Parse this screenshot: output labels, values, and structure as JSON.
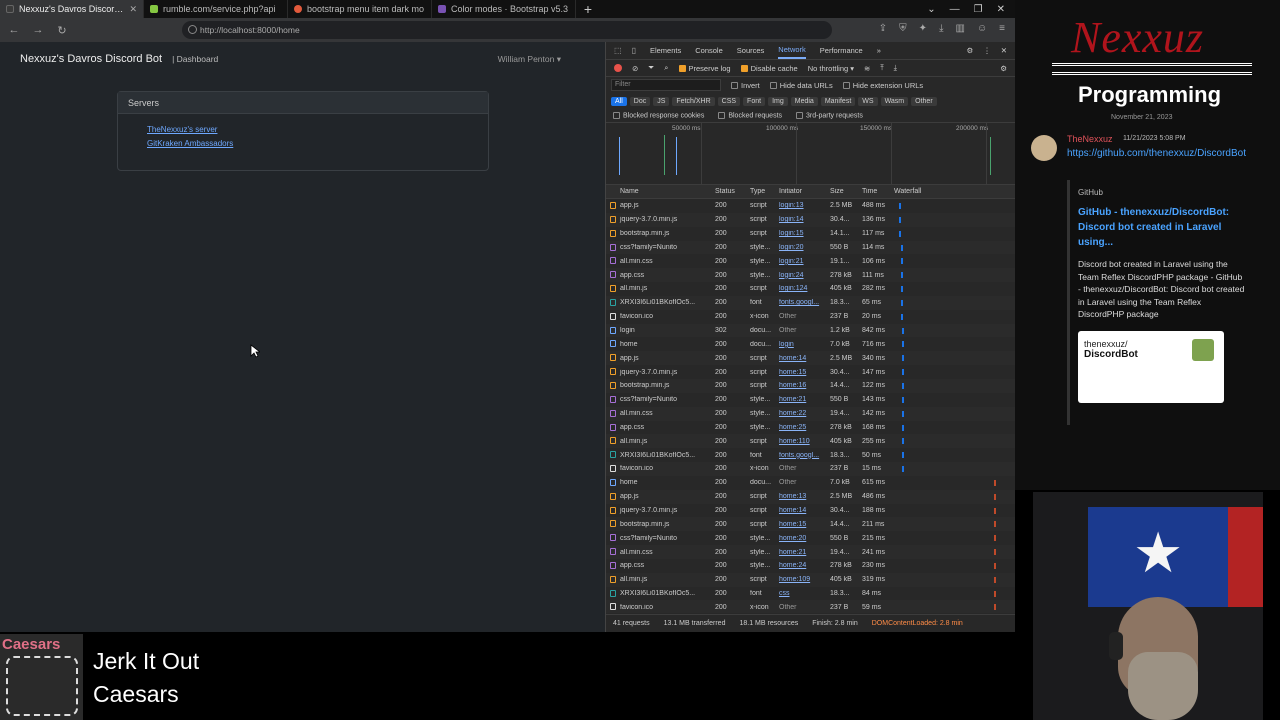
{
  "browser": {
    "tabs": [
      {
        "label": "Nexxuz's Davros Discord B",
        "active": true,
        "color": "#3a3a3a"
      },
      {
        "label": "rumble.com/service.php?api",
        "active": false,
        "color": "#85c742"
      },
      {
        "label": "bootstrap menu item dark mo",
        "active": false,
        "color": "#e25a3c"
      },
      {
        "label": "Color modes · Bootstrap v5.3",
        "active": false,
        "color": "#7952b3"
      }
    ],
    "url": "http://localhost:8000/home"
  },
  "page": {
    "brand": "Nexxuz's Davros Discord Bot",
    "nav_dashboard": "| Dashboard",
    "user": "William Penton",
    "card_header": "Servers",
    "servers": [
      "TheNexxuz's server",
      "GitKraken Ambassadors"
    ]
  },
  "devtools": {
    "tabs": [
      "Elements",
      "Console",
      "Sources",
      "Network",
      "Performance"
    ],
    "active_tab": "Network",
    "preserve_log": "Preserve log",
    "disable_cache": "Disable cache",
    "throttling": "No throttling",
    "filter_placeholder": "Filter",
    "invert": "Invert",
    "hide_data_urls": "Hide data URLs",
    "hide_extension_urls": "Hide extension URLs",
    "types": [
      "All",
      "Doc",
      "JS",
      "Fetch/XHR",
      "CSS",
      "Font",
      "Img",
      "Media",
      "Manifest",
      "WS",
      "Wasm",
      "Other"
    ],
    "blocked_cookies": "Blocked response cookies",
    "blocked_requests": "Blocked requests",
    "third_party": "3rd-party requests",
    "overview_ticks": [
      "50000 ms",
      "100000 ms",
      "150000 ms",
      "200000 ms"
    ],
    "columns": [
      "Name",
      "Status",
      "Type",
      "Initiator",
      "Size",
      "Time",
      "Waterfall"
    ],
    "rows": [
      {
        "name": "app.js",
        "status": "200",
        "type": "script",
        "initiator": "login:13",
        "size": "2.5 MB",
        "time": "488 ms",
        "kind": "js",
        "wf": 0.07
      },
      {
        "name": "jquery-3.7.0.min.js",
        "status": "200",
        "type": "script",
        "initiator": "login:14",
        "size": "30.4...",
        "time": "136 ms",
        "kind": "js",
        "wf": 0.07
      },
      {
        "name": "bootstrap.min.js",
        "status": "200",
        "type": "script",
        "initiator": "login:15",
        "size": "14.1...",
        "time": "117 ms",
        "kind": "js",
        "wf": 0.07
      },
      {
        "name": "css?family=Nunito",
        "status": "200",
        "type": "style...",
        "initiator": "login:20",
        "size": "550 B",
        "time": "114 ms",
        "kind": "css",
        "wf": 0.09
      },
      {
        "name": "all.min.css",
        "status": "200",
        "type": "style...",
        "initiator": "login:21",
        "size": "19.1...",
        "time": "106 ms",
        "kind": "css",
        "wf": 0.09
      },
      {
        "name": "app.css",
        "status": "200",
        "type": "style...",
        "initiator": "login:24",
        "size": "278 kB",
        "time": "111 ms",
        "kind": "css",
        "wf": 0.09
      },
      {
        "name": "all.min.js",
        "status": "200",
        "type": "script",
        "initiator": "login:124",
        "size": "405 kB",
        "time": "282 ms",
        "kind": "js",
        "wf": 0.09
      },
      {
        "name": "XRXI3I6Li01BKofIOc5...",
        "status": "200",
        "type": "font",
        "initiator": "fonts.googl...",
        "size": "18.3...",
        "time": "65 ms",
        "kind": "font",
        "wf": 0.09
      },
      {
        "name": "favicon.ico",
        "status": "200",
        "type": "x-icon",
        "initiator": "Other",
        "size": "237 B",
        "time": "20 ms",
        "kind": "other",
        "wf": 0.09
      },
      {
        "name": "login",
        "status": "302",
        "type": "docu...",
        "initiator": "Other",
        "size": "1.2 kB",
        "time": "842 ms",
        "kind": "doc",
        "wf": 0.1
      },
      {
        "name": "home",
        "status": "200",
        "type": "docu...",
        "initiator": "login",
        "size": "7.0 kB",
        "time": "716 ms",
        "kind": "doc",
        "wf": 0.1
      },
      {
        "name": "app.js",
        "status": "200",
        "type": "script",
        "initiator": "home:14",
        "size": "2.5 MB",
        "time": "340 ms",
        "kind": "js",
        "wf": 0.1
      },
      {
        "name": "jquery-3.7.0.min.js",
        "status": "200",
        "type": "script",
        "initiator": "home:15",
        "size": "30.4...",
        "time": "147 ms",
        "kind": "js",
        "wf": 0.1
      },
      {
        "name": "bootstrap.min.js",
        "status": "200",
        "type": "script",
        "initiator": "home:16",
        "size": "14.4...",
        "time": "122 ms",
        "kind": "js",
        "wf": 0.1
      },
      {
        "name": "css?family=Nunito",
        "status": "200",
        "type": "style...",
        "initiator": "home:21",
        "size": "550 B",
        "time": "143 ms",
        "kind": "css",
        "wf": 0.1
      },
      {
        "name": "all.min.css",
        "status": "200",
        "type": "style...",
        "initiator": "home:22",
        "size": "19.4...",
        "time": "142 ms",
        "kind": "css",
        "wf": 0.1
      },
      {
        "name": "app.css",
        "status": "200",
        "type": "style...",
        "initiator": "home:25",
        "size": "278 kB",
        "time": "168 ms",
        "kind": "css",
        "wf": 0.1
      },
      {
        "name": "all.min.js",
        "status": "200",
        "type": "script",
        "initiator": "home:110",
        "size": "405 kB",
        "time": "255 ms",
        "kind": "js",
        "wf": 0.1
      },
      {
        "name": "XRXI3I6Li01BKofIOc5...",
        "status": "200",
        "type": "font",
        "initiator": "fonts.googl...",
        "size": "18.3...",
        "time": "50 ms",
        "kind": "font",
        "wf": 0.1
      },
      {
        "name": "favicon.ico",
        "status": "200",
        "type": "x-icon",
        "initiator": "Other",
        "size": "237 B",
        "time": "15 ms",
        "kind": "other",
        "wf": 0.1
      },
      {
        "name": "home",
        "status": "200",
        "type": "docu...",
        "initiator": "Other",
        "size": "7.0 kB",
        "time": "615 ms",
        "kind": "doc",
        "wf": 0.98
      },
      {
        "name": "app.js",
        "status": "200",
        "type": "script",
        "initiator": "home:13",
        "size": "2.5 MB",
        "time": "486 ms",
        "kind": "js",
        "wf": 0.98
      },
      {
        "name": "jquery-3.7.0.min.js",
        "status": "200",
        "type": "script",
        "initiator": "home:14",
        "size": "30.4...",
        "time": "188 ms",
        "kind": "js",
        "wf": 0.98
      },
      {
        "name": "bootstrap.min.js",
        "status": "200",
        "type": "script",
        "initiator": "home:15",
        "size": "14.4...",
        "time": "211 ms",
        "kind": "js",
        "wf": 0.98
      },
      {
        "name": "css?family=Nunito",
        "status": "200",
        "type": "style...",
        "initiator": "home:20",
        "size": "550 B",
        "time": "215 ms",
        "kind": "css",
        "wf": 0.98
      },
      {
        "name": "all.min.css",
        "status": "200",
        "type": "style...",
        "initiator": "home:21",
        "size": "19.4...",
        "time": "241 ms",
        "kind": "css",
        "wf": 0.98
      },
      {
        "name": "app.css",
        "status": "200",
        "type": "style...",
        "initiator": "home:24",
        "size": "278 kB",
        "time": "230 ms",
        "kind": "css",
        "wf": 0.98
      },
      {
        "name": "all.min.js",
        "status": "200",
        "type": "script",
        "initiator": "home:109",
        "size": "405 kB",
        "time": "319 ms",
        "kind": "js",
        "wf": 0.98
      },
      {
        "name": "XRXI3I6Li01BKofIOc5...",
        "status": "200",
        "type": "font",
        "initiator": "css",
        "size": "18.3...",
        "time": "84 ms",
        "kind": "font",
        "wf": 0.98
      },
      {
        "name": "favicon.ico",
        "status": "200",
        "type": "x-icon",
        "initiator": "Other",
        "size": "237 B",
        "time": "59 ms",
        "kind": "other",
        "wf": 0.98
      }
    ],
    "status": {
      "requests": "41 requests",
      "transferred": "13.1 MB transferred",
      "resources": "18.1 MB resources",
      "finish": "Finish: 2.8 min",
      "dcl": "DOMContentLoaded: 2.8 min"
    }
  },
  "chat": {
    "logo": "Nexxuz",
    "subtitle": "Programming",
    "date": "November 21, 2023",
    "username": "TheNexxuz",
    "time": "11/21/2023 5:08 PM",
    "link": "https://github.com/thenexxuz/DiscordBot",
    "embed_site": "GitHub",
    "embed_title": "GitHub - thenexxuz/DiscordBot: Discord bot created in Laravel using...",
    "embed_desc": "Discord bot created in Laravel using the Team Reflex DiscordPHP package - GitHub - thenexxuz/DiscordBot: Discord bot created in Laravel using the Team Reflex DiscordPHP package",
    "embed_img_line1": "thenexxuz/",
    "embed_img_line2": "DiscordBot"
  },
  "now_playing": {
    "art_text": "Caesars",
    "title": "Jerk It Out",
    "artist": "Caesars"
  },
  "colors": {
    "js": "#f0a02a",
    "css": "#a66fd6",
    "font": "#2aa3a3",
    "doc": "#6ea8fe",
    "other": "#dddddd"
  }
}
